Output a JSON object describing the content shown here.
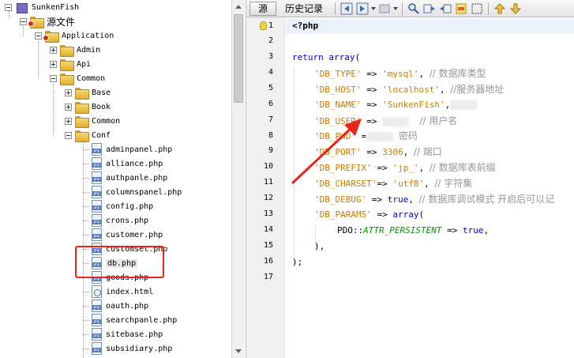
{
  "tree": {
    "project": "SunkenFish",
    "source_folder": "源文件",
    "application": "Application",
    "admin": "Admin",
    "api": "Api",
    "common": "Common",
    "base": "Base",
    "book": "Book",
    "common_sub": "Common",
    "conf": "Conf",
    "files": [
      "adminpanel.php",
      "alliance.php",
      "authpanle.php",
      "columnspanel.php",
      "config.php",
      "crons.php",
      "customer.php",
      "customset.php",
      "db.php",
      "goods.php",
      "index.html",
      "oauth.php",
      "searchpanle.php",
      "sitebase.php",
      "subsidiary.php"
    ]
  },
  "toolbar": {
    "source_tab": "源",
    "history_tab": "历史记录",
    "icons": [
      "back-icon",
      "forward-icon",
      "history-dropdown-icon",
      "find-icon",
      "find-prev-icon",
      "find-next-icon",
      "toggle-highlight-icon",
      "toggle-rect-select-icon",
      "prev-bookmark-icon",
      "next-bookmark-icon"
    ]
  },
  "editor": {
    "line_numbers": [
      "1",
      "2",
      "3",
      "4",
      "5",
      "6",
      "7",
      "8",
      "9",
      "10",
      "11",
      "12",
      "13",
      "14",
      "15",
      "16",
      "17"
    ],
    "php_open": "<?php",
    "l3": {
      "kw": "return",
      "fn": "array",
      "paren": "("
    },
    "l4": {
      "key": "'DB_TYPE'",
      "op": " => ",
      "val": "'mysql'",
      "rest": ", ",
      "cm": "// 数据库类型"
    },
    "l5": {
      "key": "'DB_HOST'",
      "op": " => ",
      "val": "'localhost'",
      "rest": ", ",
      "cm": "//服务器地址"
    },
    "l6": {
      "key": "'DB_NAME'",
      "op": " => ",
      "val": "'SunkenFish'",
      "rest": ","
    },
    "l7": {
      "key": "'DB_USER'",
      "op": " => ",
      "cm": "// 用户名"
    },
    "l8": {
      "key": "'DB_PWD'",
      "op": " =",
      "cm": "密码"
    },
    "l9": {
      "key": "'DB_PORT'",
      "op": " => ",
      "val": "3306",
      "rest": ", ",
      "cm": "// 端口"
    },
    "l10": {
      "key": "'DB_PREFIX'",
      "op": " => ",
      "val": "'jp_'",
      "rest": ", ",
      "cm": "// 数据库表前缀"
    },
    "l11": {
      "key": "'DB_CHARSET'",
      "op": "=> ",
      "val": "'utf8'",
      "rest": ", ",
      "cm": "// 字符集"
    },
    "l12": {
      "key": "'DB_DEBUG'",
      "op": " => ",
      "val": "true",
      "rest": ", ",
      "cm": "// 数据库调试模式 开启后可以记"
    },
    "l13": {
      "key": "'DB_PARAMS'",
      "op": " => ",
      "fn": "array",
      "paren": "("
    },
    "l14": {
      "cls": "PDO",
      "sep": "::",
      "const": "ATTR_PERSISTENT",
      "op": " => ",
      "val": "true",
      "rest": ","
    },
    "l15": {
      "text": "),"
    },
    "l16": {
      "text": ");"
    }
  },
  "colors": {
    "annotation_red": "#e8251b",
    "keyword_blue": "#0000e6",
    "string_orange": "#ce7b00",
    "comment_gray": "#969696"
  }
}
